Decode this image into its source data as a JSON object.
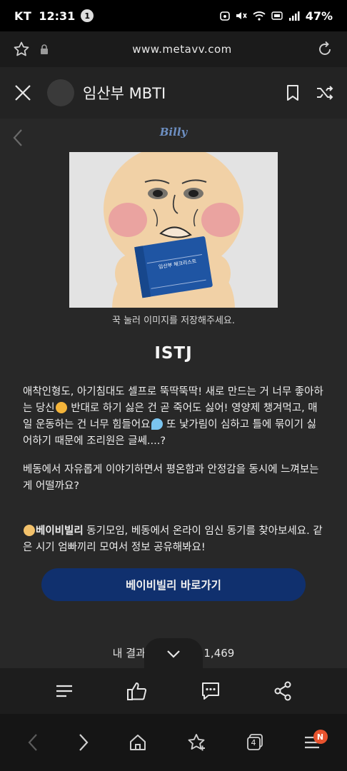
{
  "status_bar": {
    "carrier": "KT",
    "time": "12:31",
    "notification_count": "1",
    "battery": "47%"
  },
  "browser": {
    "url": "www.metavv.com"
  },
  "app_header": {
    "title": "임산부 MBTI"
  },
  "content": {
    "brand": "Billy",
    "image_text": "임산부 체크리스트",
    "caption": "꾹 눌러 이미지를 저장해주세요.",
    "result_type": "ISTJ",
    "paragraph1_a": "애착인형도, 아기침대도 셀프로 뚝딱뚝딱! 새로 만드는 거 너무 좋아하는 당신",
    "paragraph1_b": " 반대로 하기 싫은 건 곧 죽어도 싫어! 영양제 챙겨먹고, 매일 운동하는 건 너무 힘들어요",
    "paragraph1_c": " 또 낯가림이 심하고 틀에 묶이기 싫어하기 때문에 조리원은 글쎄....?",
    "paragraph2": "베동에서 자유롭게 이야기하면서 평온함과 안정감을 동시에 느껴보는 게 어떨까요?",
    "paragraph3_bold": "베이비빌리",
    "paragraph3_rest": " 동기모임, 베동에서 온라이 임신 동기를 찾아보세요. 같은 시기 엄빠끼리 모여서 정보 공유해봐요!",
    "cta_label": "베이비빌리 바로가기",
    "result_count_prefix": "내 결과",
    "result_count_value": "1,469"
  },
  "bottom_nav": {
    "tabs_count": "4",
    "menu_badge": "N"
  },
  "colors": {
    "cta_bg": "#10306e",
    "badge": "#e8532e",
    "brand": "#6d8fc2"
  }
}
